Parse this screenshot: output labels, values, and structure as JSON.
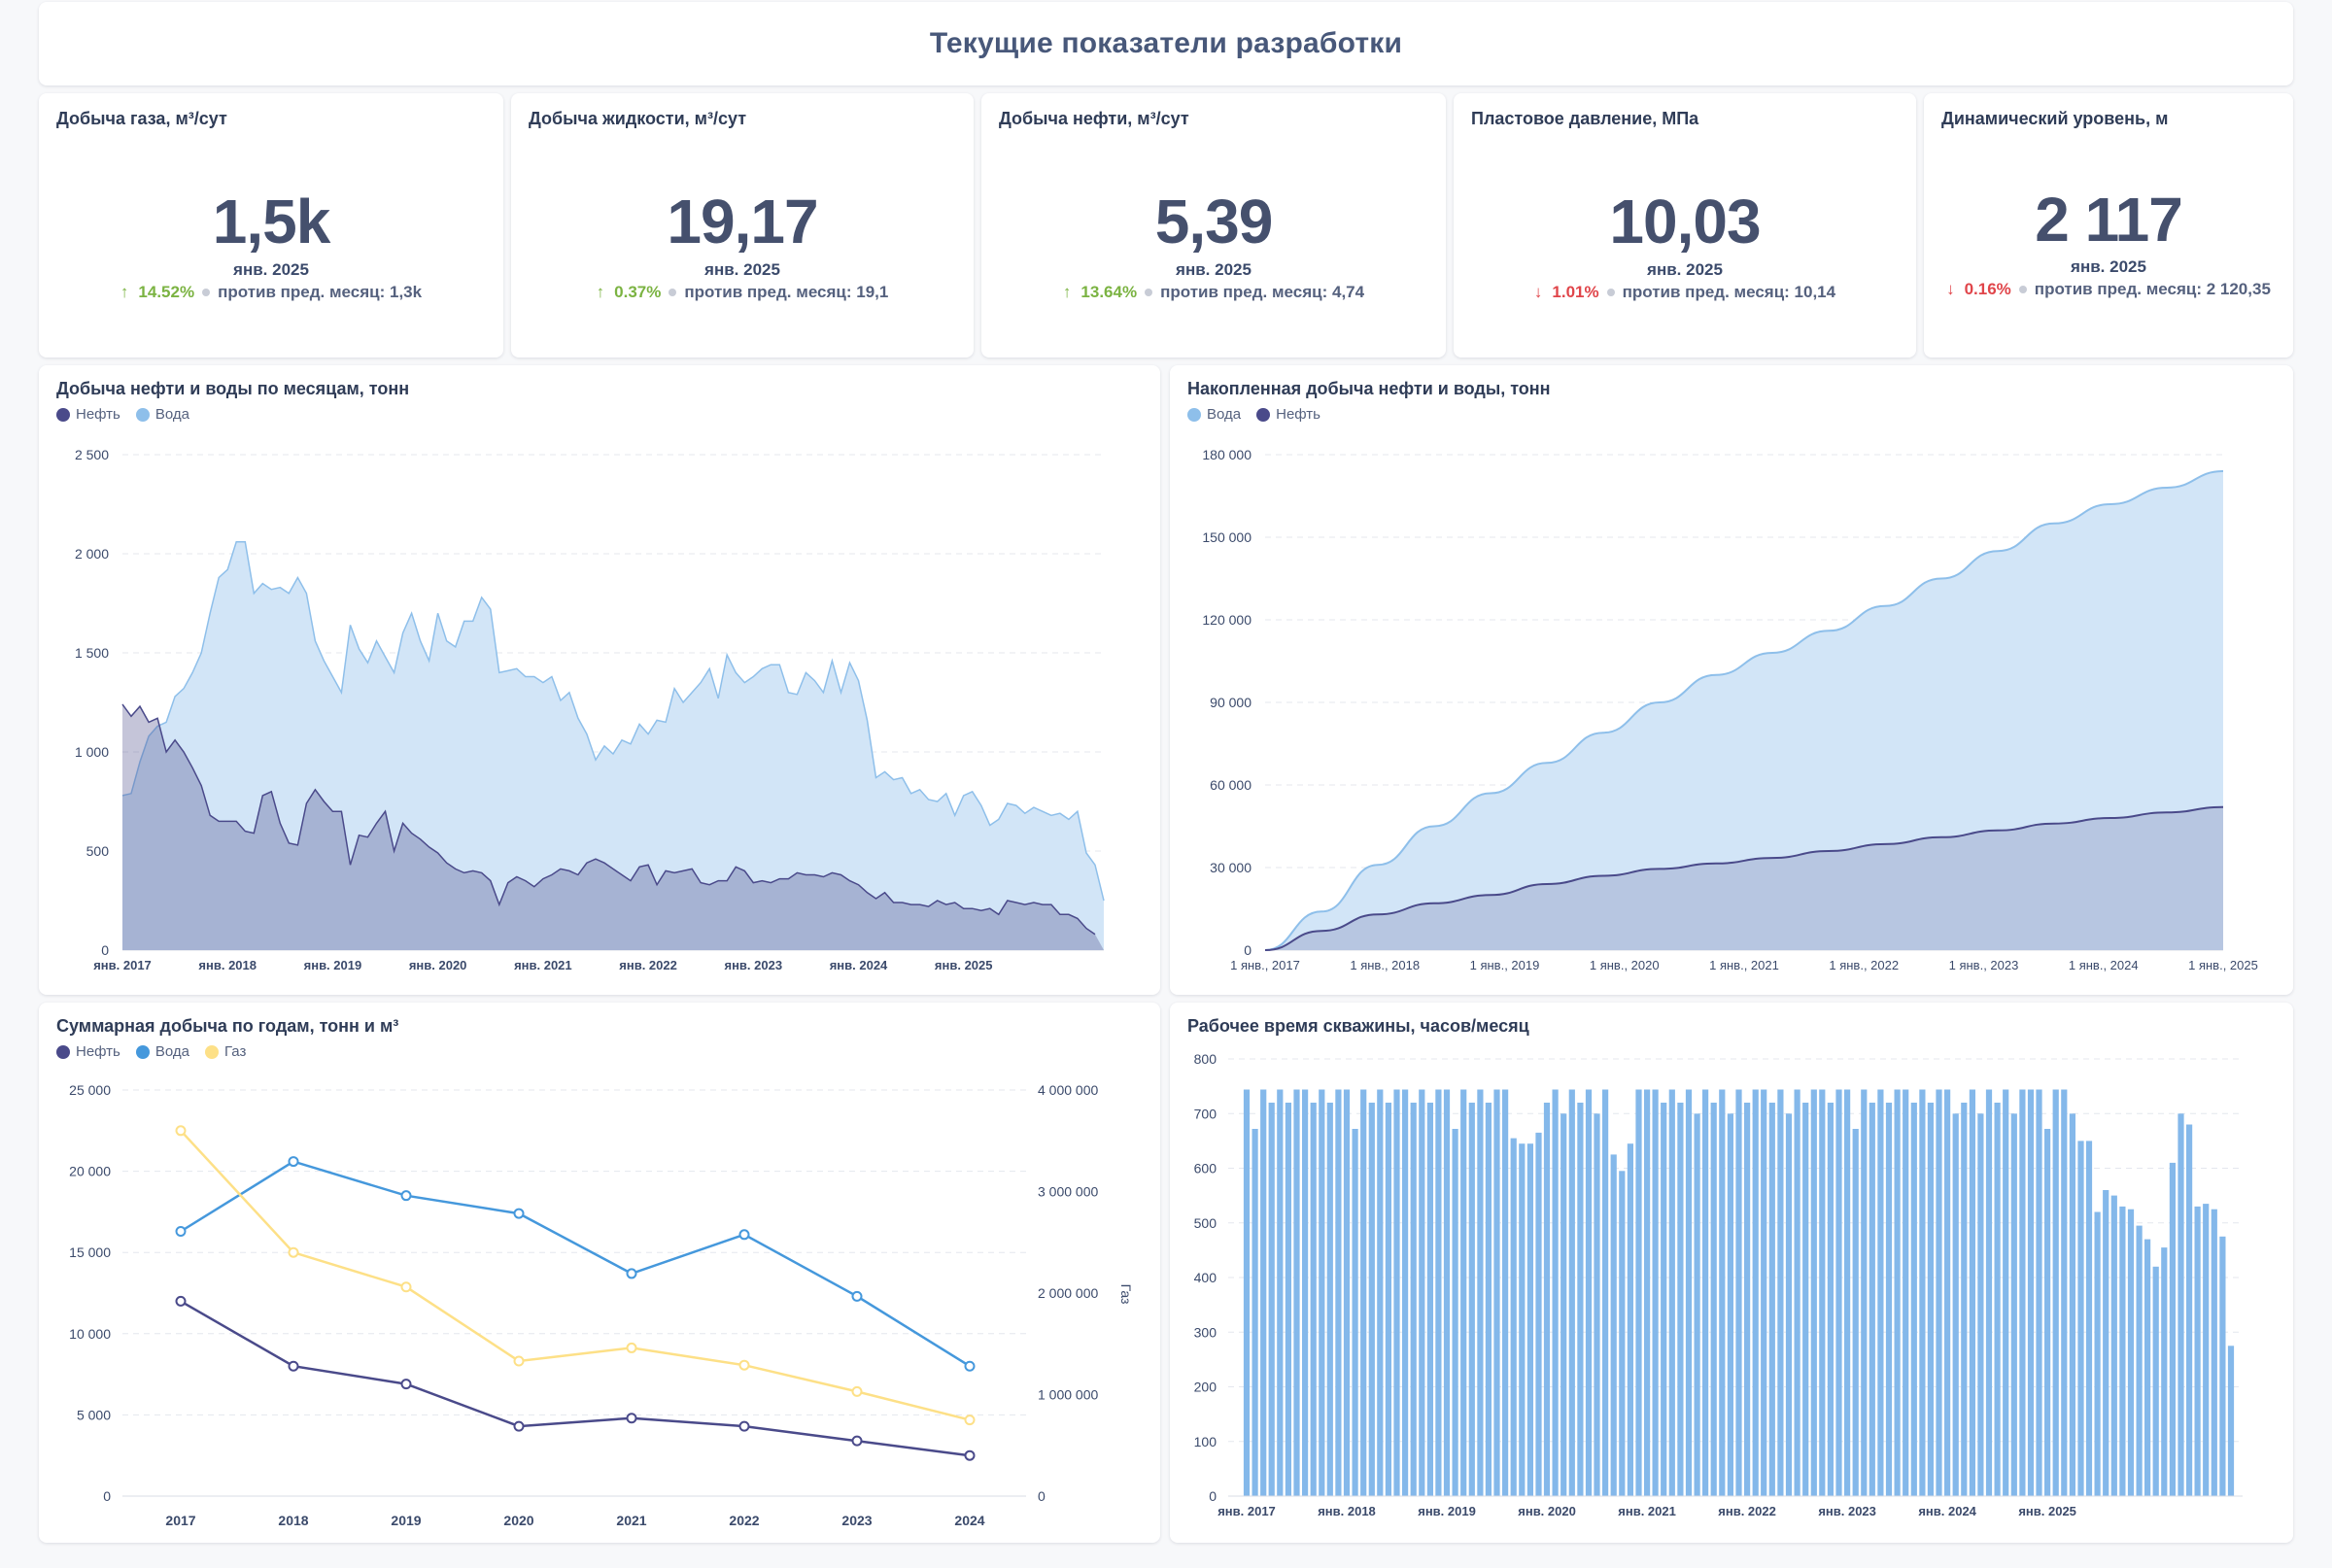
{
  "page": {
    "title": "Текущие показатели разработки"
  },
  "kpis": [
    {
      "title": "Добыча газа, м³/сут",
      "value": "1,5k",
      "date": "янв. 2025",
      "dir": "up",
      "arrow": "↑",
      "delta": "14.52%",
      "compare": "против пред. месяц: 1,3k"
    },
    {
      "title": "Добыча жидкости, м³/сут",
      "value": "19,17",
      "date": "янв. 2025",
      "dir": "up",
      "arrow": "↑",
      "delta": "0.37%",
      "compare": "против пред. месяц: 19,1"
    },
    {
      "title": "Добыча нефти, м³/сут",
      "value": "5,39",
      "date": "янв. 2025",
      "dir": "up",
      "arrow": "↑",
      "delta": "13.64%",
      "compare": "против пред. месяц: 4,74"
    },
    {
      "title": "Пластовое давление, МПа",
      "value": "10,03",
      "date": "янв. 2025",
      "dir": "down",
      "arrow": "↓",
      "delta": "1.01%",
      "compare": "против пред. месяц: 10,14"
    },
    {
      "title": "Динамический уровень, м",
      "value": "2 117",
      "date": "янв. 2025",
      "dir": "down",
      "arrow": "↓",
      "delta": "0.16%",
      "compare": "против пред. месяц: 2 120,35"
    }
  ],
  "colors": {
    "oil": "#4a4a8a",
    "water_light": "#8ebfea",
    "water": "#4598dc",
    "gas": "#fde087",
    "bar": "#84b8ea"
  },
  "chart_data": [
    {
      "type": "area",
      "title": "Добыча нефти и воды по месяцам, тонн",
      "legend": [
        "Нефть",
        "Вода"
      ],
      "legend_placement": "top-left",
      "grid": true,
      "ylim": [
        0,
        2500
      ],
      "yticks": [
        "0",
        "500",
        "1 000",
        "1 500",
        "2 000",
        "2 500"
      ],
      "xticks": [
        "янв. 2017",
        "янв. 2018",
        "янв. 2019",
        "янв. 2020",
        "янв. 2021",
        "янв. 2022",
        "янв. 2023",
        "янв. 2024",
        "янв. 2025"
      ],
      "x_start": "2017-01",
      "series": [
        {
          "name": "Вода",
          "values": [
            780,
            790,
            950,
            1080,
            1130,
            1150,
            1280,
            1320,
            1400,
            1500,
            1700,
            1880,
            1920,
            2060,
            2060,
            1800,
            1850,
            1820,
            1830,
            1800,
            1880,
            1800,
            1560,
            1460,
            1380,
            1300,
            1640,
            1520,
            1450,
            1560,
            1480,
            1400,
            1600,
            1700,
            1560,
            1460,
            1700,
            1560,
            1530,
            1660,
            1660,
            1780,
            1720,
            1400,
            1410,
            1420,
            1380,
            1380,
            1350,
            1380,
            1260,
            1300,
            1170,
            1090,
            960,
            1030,
            990,
            1060,
            1040,
            1140,
            1090,
            1160,
            1150,
            1320,
            1250,
            1300,
            1350,
            1420,
            1270,
            1490,
            1400,
            1350,
            1380,
            1420,
            1440,
            1440,
            1300,
            1290,
            1400,
            1360,
            1300,
            1460,
            1300,
            1450,
            1360,
            1160,
            870,
            900,
            860,
            870,
            790,
            810,
            760,
            750,
            790,
            680,
            780,
            800,
            730,
            630,
            660,
            740,
            730,
            690,
            720,
            700,
            680,
            690,
            660,
            700,
            490,
            430,
            250
          ]
        },
        {
          "name": "Нефть",
          "values": [
            1240,
            1180,
            1230,
            1150,
            1170,
            1000,
            1060,
            1000,
            920,
            830,
            680,
            650,
            650,
            650,
            600,
            590,
            780,
            800,
            640,
            540,
            530,
            740,
            810,
            750,
            700,
            700,
            430,
            580,
            570,
            640,
            700,
            500,
            640,
            590,
            560,
            520,
            490,
            440,
            410,
            390,
            400,
            390,
            350,
            230,
            340,
            370,
            350,
            320,
            360,
            380,
            410,
            400,
            380,
            440,
            460,
            440,
            410,
            380,
            350,
            420,
            430,
            330,
            400,
            390,
            400,
            410,
            340,
            330,
            350,
            350,
            420,
            400,
            340,
            350,
            340,
            360,
            360,
            390,
            380,
            380,
            370,
            390,
            380,
            350,
            330,
            290,
            260,
            290,
            240,
            240,
            230,
            230,
            220,
            250,
            230,
            240,
            210,
            210,
            200,
            210,
            180,
            250,
            240,
            230,
            240,
            230,
            230,
            180,
            180,
            160,
            110,
            80
          ]
        }
      ]
    },
    {
      "type": "area",
      "title": "Накопленная добыча нефти и воды, тонн",
      "legend": [
        "Вода",
        "Нефть"
      ],
      "legend_placement": "top-left",
      "grid": true,
      "ylim": [
        0,
        180000
      ],
      "yticks": [
        "0",
        "30 000",
        "60 000",
        "90 000",
        "120 000",
        "150 000",
        "180 000"
      ],
      "xticks": [
        "1 янв., 2017",
        "1 янв., 2018",
        "1 янв., 2019",
        "1 янв., 2020",
        "1 янв., 2021",
        "1 янв., 2022",
        "1 янв., 2023",
        "1 янв., 2024",
        "1 янв., 2025"
      ],
      "x": [
        "2017-01-01",
        "2017-07-01",
        "2018-01-01",
        "2018-07-01",
        "2019-01-01",
        "2019-07-01",
        "2020-01-01",
        "2020-07-01",
        "2021-01-01",
        "2021-07-01",
        "2022-01-01",
        "2022-07-01",
        "2023-01-01",
        "2023-07-01",
        "2024-01-01",
        "2024-07-01",
        "2025-01-01"
      ],
      "series": [
        {
          "name": "Вода",
          "values": [
            0,
            14000,
            31000,
            45000,
            57000,
            68000,
            79000,
            90000,
            100000,
            108000,
            116000,
            125000,
            135000,
            145000,
            155000,
            162000,
            168000,
            174000
          ]
        },
        {
          "name": "Нефть",
          "values": [
            0,
            7000,
            13000,
            17000,
            20000,
            24000,
            27000,
            29500,
            31500,
            33500,
            36000,
            38500,
            41000,
            43500,
            46000,
            48000,
            50000,
            52000
          ]
        }
      ]
    },
    {
      "type": "line",
      "title": "Суммарная добыча по годам, тонн и м³",
      "legend": [
        "Нефть",
        "Вода",
        "Газ"
      ],
      "legend_placement": "top-left",
      "grid": true,
      "categories": [
        "2017",
        "2018",
        "2019",
        "2020",
        "2021",
        "2022",
        "2023",
        "2024"
      ],
      "ylim": [
        0,
        25000
      ],
      "yticks": [
        "0",
        "5 000",
        "10 000",
        "15 000",
        "20 000",
        "25 000"
      ],
      "y2lim": [
        0,
        4000000
      ],
      "y2ticks": [
        "0",
        "1 000 000",
        "2 000 000",
        "3 000 000",
        "4 000 000"
      ],
      "y2label": "Газ",
      "series": [
        {
          "name": "Нефть",
          "axis": "left",
          "values": [
            12000,
            8000,
            6900,
            4300,
            4800,
            4300,
            3400,
            2500
          ]
        },
        {
          "name": "Вода",
          "axis": "left",
          "values": [
            16300,
            20600,
            18500,
            17400,
            13700,
            16100,
            12300,
            8000
          ]
        },
        {
          "name": "Газ",
          "axis": "right",
          "values": [
            3600000,
            2400000,
            2060000,
            1330000,
            1460000,
            1290000,
            1030000,
            750000
          ]
        }
      ]
    },
    {
      "type": "bar",
      "title": "Рабочее время скважины, часов/месяц",
      "grid": true,
      "ylim": [
        0,
        800
      ],
      "yticks": [
        "0",
        "100",
        "200",
        "300",
        "400",
        "500",
        "600",
        "700",
        "800"
      ],
      "xticks": [
        "янв. 2017",
        "янв. 2018",
        "янв. 2019",
        "янв. 2020",
        "янв. 2021",
        "янв. 2022",
        "янв. 2023",
        "янв. 2024",
        "янв. 2025"
      ],
      "x_start": "2017-01",
      "values": [
        744,
        672,
        744,
        720,
        744,
        720,
        744,
        744,
        720,
        744,
        720,
        744,
        744,
        672,
        744,
        720,
        744,
        720,
        744,
        744,
        720,
        744,
        720,
        744,
        744,
        672,
        744,
        720,
        744,
        720,
        744,
        744,
        655,
        645,
        645,
        665,
        720,
        744,
        700,
        744,
        720,
        744,
        700,
        744,
        625,
        595,
        645,
        744,
        744,
        744,
        720,
        744,
        720,
        744,
        700,
        744,
        720,
        744,
        700,
        744,
        720,
        744,
        744,
        720,
        744,
        700,
        744,
        720,
        744,
        744,
        720,
        744,
        744,
        672,
        744,
        720,
        744,
        720,
        744,
        744,
        720,
        744,
        720,
        744,
        744,
        700,
        720,
        744,
        700,
        744,
        720,
        744,
        700,
        744,
        744,
        744,
        672,
        744,
        744,
        700,
        650,
        650,
        520,
        560,
        550,
        530,
        525,
        495,
        470,
        420,
        455,
        610,
        700,
        680,
        530,
        535,
        525,
        475,
        275
      ]
    }
  ]
}
